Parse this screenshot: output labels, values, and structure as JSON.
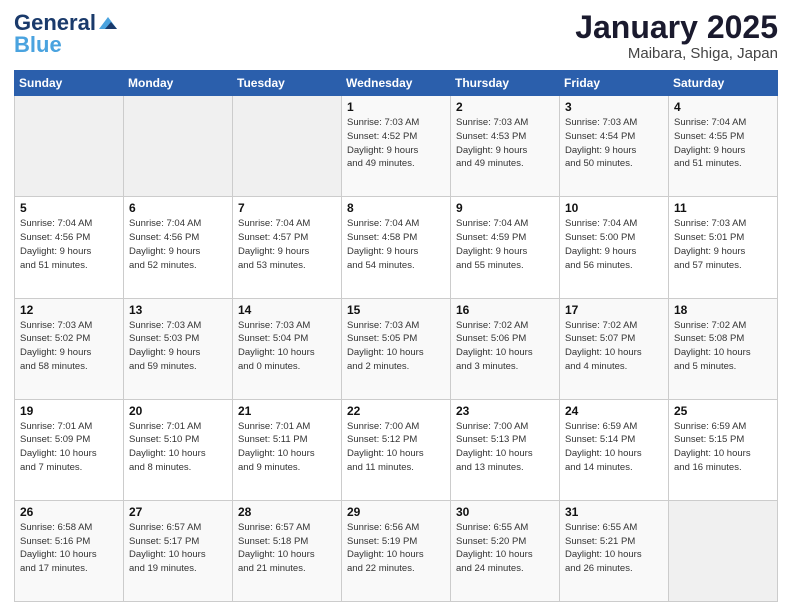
{
  "header": {
    "logo_general": "General",
    "logo_blue": "Blue",
    "title": "January 2025",
    "subtitle": "Maibara, Shiga, Japan"
  },
  "days_of_week": [
    "Sunday",
    "Monday",
    "Tuesday",
    "Wednesday",
    "Thursday",
    "Friday",
    "Saturday"
  ],
  "weeks": [
    [
      {
        "day": "",
        "info": ""
      },
      {
        "day": "",
        "info": ""
      },
      {
        "day": "",
        "info": ""
      },
      {
        "day": "1",
        "info": "Sunrise: 7:03 AM\nSunset: 4:52 PM\nDaylight: 9 hours\nand 49 minutes."
      },
      {
        "day": "2",
        "info": "Sunrise: 7:03 AM\nSunset: 4:53 PM\nDaylight: 9 hours\nand 49 minutes."
      },
      {
        "day": "3",
        "info": "Sunrise: 7:03 AM\nSunset: 4:54 PM\nDaylight: 9 hours\nand 50 minutes."
      },
      {
        "day": "4",
        "info": "Sunrise: 7:04 AM\nSunset: 4:55 PM\nDaylight: 9 hours\nand 51 minutes."
      }
    ],
    [
      {
        "day": "5",
        "info": "Sunrise: 7:04 AM\nSunset: 4:56 PM\nDaylight: 9 hours\nand 51 minutes."
      },
      {
        "day": "6",
        "info": "Sunrise: 7:04 AM\nSunset: 4:56 PM\nDaylight: 9 hours\nand 52 minutes."
      },
      {
        "day": "7",
        "info": "Sunrise: 7:04 AM\nSunset: 4:57 PM\nDaylight: 9 hours\nand 53 minutes."
      },
      {
        "day": "8",
        "info": "Sunrise: 7:04 AM\nSunset: 4:58 PM\nDaylight: 9 hours\nand 54 minutes."
      },
      {
        "day": "9",
        "info": "Sunrise: 7:04 AM\nSunset: 4:59 PM\nDaylight: 9 hours\nand 55 minutes."
      },
      {
        "day": "10",
        "info": "Sunrise: 7:04 AM\nSunset: 5:00 PM\nDaylight: 9 hours\nand 56 minutes."
      },
      {
        "day": "11",
        "info": "Sunrise: 7:03 AM\nSunset: 5:01 PM\nDaylight: 9 hours\nand 57 minutes."
      }
    ],
    [
      {
        "day": "12",
        "info": "Sunrise: 7:03 AM\nSunset: 5:02 PM\nDaylight: 9 hours\nand 58 minutes."
      },
      {
        "day": "13",
        "info": "Sunrise: 7:03 AM\nSunset: 5:03 PM\nDaylight: 9 hours\nand 59 minutes."
      },
      {
        "day": "14",
        "info": "Sunrise: 7:03 AM\nSunset: 5:04 PM\nDaylight: 10 hours\nand 0 minutes."
      },
      {
        "day": "15",
        "info": "Sunrise: 7:03 AM\nSunset: 5:05 PM\nDaylight: 10 hours\nand 2 minutes."
      },
      {
        "day": "16",
        "info": "Sunrise: 7:02 AM\nSunset: 5:06 PM\nDaylight: 10 hours\nand 3 minutes."
      },
      {
        "day": "17",
        "info": "Sunrise: 7:02 AM\nSunset: 5:07 PM\nDaylight: 10 hours\nand 4 minutes."
      },
      {
        "day": "18",
        "info": "Sunrise: 7:02 AM\nSunset: 5:08 PM\nDaylight: 10 hours\nand 5 minutes."
      }
    ],
    [
      {
        "day": "19",
        "info": "Sunrise: 7:01 AM\nSunset: 5:09 PM\nDaylight: 10 hours\nand 7 minutes."
      },
      {
        "day": "20",
        "info": "Sunrise: 7:01 AM\nSunset: 5:10 PM\nDaylight: 10 hours\nand 8 minutes."
      },
      {
        "day": "21",
        "info": "Sunrise: 7:01 AM\nSunset: 5:11 PM\nDaylight: 10 hours\nand 9 minutes."
      },
      {
        "day": "22",
        "info": "Sunrise: 7:00 AM\nSunset: 5:12 PM\nDaylight: 10 hours\nand 11 minutes."
      },
      {
        "day": "23",
        "info": "Sunrise: 7:00 AM\nSunset: 5:13 PM\nDaylight: 10 hours\nand 13 minutes."
      },
      {
        "day": "24",
        "info": "Sunrise: 6:59 AM\nSunset: 5:14 PM\nDaylight: 10 hours\nand 14 minutes."
      },
      {
        "day": "25",
        "info": "Sunrise: 6:59 AM\nSunset: 5:15 PM\nDaylight: 10 hours\nand 16 minutes."
      }
    ],
    [
      {
        "day": "26",
        "info": "Sunrise: 6:58 AM\nSunset: 5:16 PM\nDaylight: 10 hours\nand 17 minutes."
      },
      {
        "day": "27",
        "info": "Sunrise: 6:57 AM\nSunset: 5:17 PM\nDaylight: 10 hours\nand 19 minutes."
      },
      {
        "day": "28",
        "info": "Sunrise: 6:57 AM\nSunset: 5:18 PM\nDaylight: 10 hours\nand 21 minutes."
      },
      {
        "day": "29",
        "info": "Sunrise: 6:56 AM\nSunset: 5:19 PM\nDaylight: 10 hours\nand 22 minutes."
      },
      {
        "day": "30",
        "info": "Sunrise: 6:55 AM\nSunset: 5:20 PM\nDaylight: 10 hours\nand 24 minutes."
      },
      {
        "day": "31",
        "info": "Sunrise: 6:55 AM\nSunset: 5:21 PM\nDaylight: 10 hours\nand 26 minutes."
      },
      {
        "day": "",
        "info": ""
      }
    ]
  ]
}
